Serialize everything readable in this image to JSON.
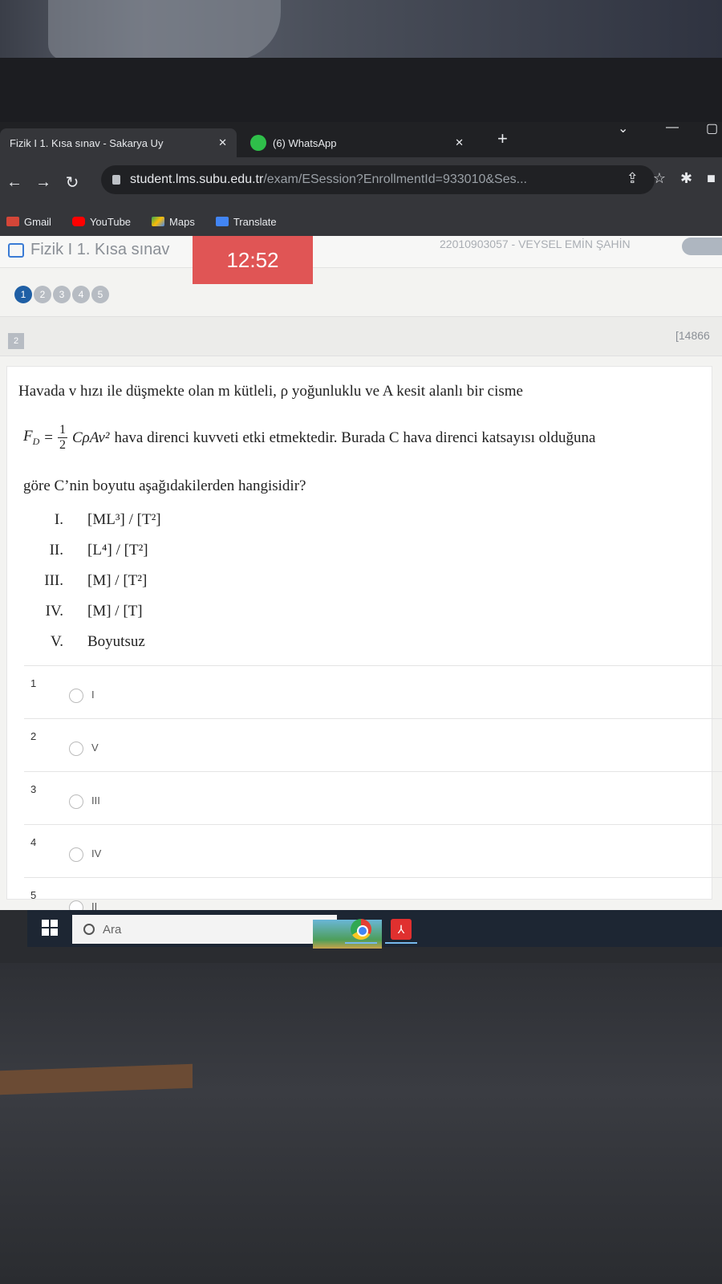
{
  "browser": {
    "tabs": [
      {
        "title": "Fizik I 1. Kısa sınav - Sakarya Uy",
        "close": "✕"
      },
      {
        "title": "(6) WhatsApp",
        "close": "✕"
      }
    ],
    "new_tab": "+",
    "url_host": "student.lms.subu.edu.tr",
    "url_path": "/exam/ESession?EnrollmentId=933010&Ses...",
    "bookmarks": [
      "Gmail",
      "YouTube",
      "Maps",
      "Translate"
    ]
  },
  "exam": {
    "title": "Fizik I 1. Kısa sınav",
    "timer": "12:52",
    "student": "22010903057 - VEYSEL EMİN ŞAHİN",
    "question_nav": [
      "1",
      "2",
      "3",
      "4",
      "5"
    ],
    "question_number": "2",
    "question_id": "[14866",
    "question_line1": "Havada v hızı ile düşmekte olan m kütleli, ρ yoğunluklu ve A kesit alanlı bir cisme",
    "formula_lhs": "F",
    "formula_sub": "D",
    "formula_num": "1",
    "formula_den": "2",
    "formula_rhs": "CρAv²",
    "question_line2": "hava direnci kuvveti etki etmektedir. Burada C hava direnci katsayısı olduğuna",
    "question_line3": "göre C’nin boyutu aşağıdakilerden hangisidir?",
    "options": [
      {
        "roman": "I.",
        "text": "[ML³] / [T²]"
      },
      {
        "roman": "II.",
        "text": "[L⁴] / [T²]"
      },
      {
        "roman": "III.",
        "text": "[M] / [T²]"
      },
      {
        "roman": "IV.",
        "text": "[M] / [T]"
      },
      {
        "roman": "V.",
        "text": "Boyutsuz"
      }
    ],
    "answers": [
      {
        "index": "1",
        "label": "I"
      },
      {
        "index": "2",
        "label": "V"
      },
      {
        "index": "3",
        "label": "III"
      },
      {
        "index": "4",
        "label": "IV"
      },
      {
        "index": "5",
        "label": "II"
      }
    ]
  },
  "taskbar": {
    "search_placeholder": "Ara"
  }
}
